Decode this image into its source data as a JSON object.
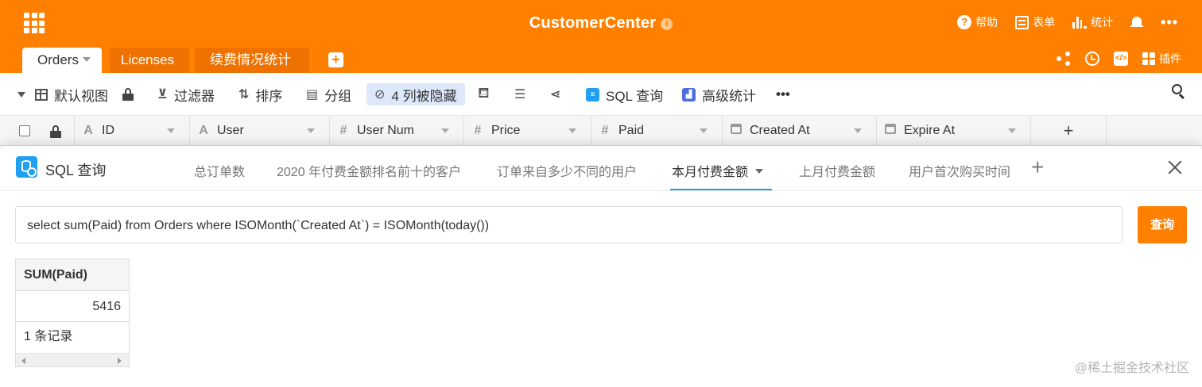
{
  "colors": {
    "brand": "#ff8000",
    "accent_blue": "#20a0f0",
    "hidden_highlight": "#dde9fb"
  },
  "app": {
    "title": "CustomerCenter",
    "info_icon": "info-icon"
  },
  "header_actions": {
    "help": "帮助",
    "form": "表单",
    "stats": "统计",
    "more": "•••"
  },
  "tabs": [
    {
      "label": "Orders"
    },
    {
      "label": "Licenses"
    },
    {
      "label": "续费情况统计"
    }
  ],
  "tab_actions": {
    "plugins": "插件"
  },
  "toolbar": {
    "view": "默认视图",
    "filter": "过滤器",
    "sort": "排序",
    "group": "分组",
    "hidden": "4 列被隐藏",
    "sql": "SQL 查询",
    "advanced_stats": "高级统计",
    "more": "•••"
  },
  "columns": [
    {
      "name": "ID",
      "icon": "A"
    },
    {
      "name": "User",
      "icon": "A"
    },
    {
      "name": "User Num",
      "icon": "#"
    },
    {
      "name": "Price",
      "icon": "#"
    },
    {
      "name": "Paid",
      "icon": "#"
    },
    {
      "name": "Created At",
      "icon": "calendar-icon"
    },
    {
      "name": "Expire At",
      "icon": "calendar-icon"
    }
  ],
  "add_column": "+",
  "sql_panel": {
    "title": "SQL 查询",
    "query_tabs": [
      "总订单数",
      "2020 年付费金额排名前十的客户",
      "订单来自多少不同的用户",
      "本月付费金额",
      "上月付费金额",
      "用户首次购买时间"
    ],
    "active_query": "本月付费金额",
    "query_text": "select sum(Paid) from Orders where ISOMonth(`Created At`) = ISOMonth(today())",
    "run_label": "查询",
    "result": {
      "column": "SUM(Paid)",
      "value": "5416",
      "count_text": "1 条记录"
    }
  },
  "watermark": "@稀土掘金技术社区"
}
